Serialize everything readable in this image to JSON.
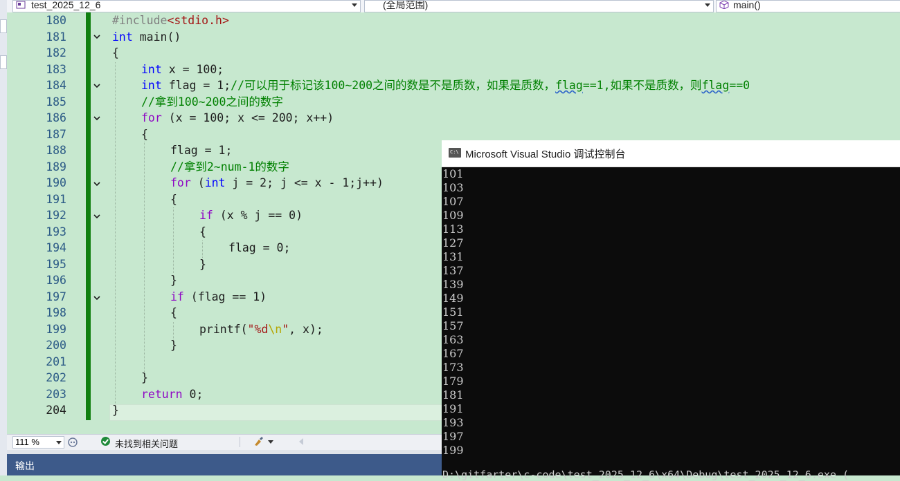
{
  "nav": {
    "project": "test_2025_12_6",
    "scope": "(全局范围)",
    "member": "main()"
  },
  "editor": {
    "lines": [
      {
        "num": "180"
      },
      {
        "num": "181"
      },
      {
        "num": "182"
      },
      {
        "num": "183"
      },
      {
        "num": "184"
      },
      {
        "num": "185"
      },
      {
        "num": "186"
      },
      {
        "num": "187"
      },
      {
        "num": "188"
      },
      {
        "num": "189"
      },
      {
        "num": "190"
      },
      {
        "num": "191"
      },
      {
        "num": "192"
      },
      {
        "num": "193"
      },
      {
        "num": "194"
      },
      {
        "num": "195"
      },
      {
        "num": "196"
      },
      {
        "num": "197"
      },
      {
        "num": "198"
      },
      {
        "num": "199"
      },
      {
        "num": "200"
      },
      {
        "num": "201"
      },
      {
        "num": "202"
      },
      {
        "num": "203"
      },
      {
        "num": "204"
      }
    ],
    "code": {
      "l180_pp": "#include",
      "l180_hdr": "<stdio.h>",
      "l181_kw": "int",
      "l181_rest": " main()",
      "l182": "{",
      "l183_kw": "int",
      "l183_rest": " x = 100;",
      "l184_kw": "int",
      "l184_rest": " flag = 1;",
      "l184_cmt_a": "//可以用于标记该100~200之间的数是不是质数，如果是质数，",
      "l184_cmt_b": "flag",
      "l184_cmt_c": "==1,如果不是质数，则",
      "l184_cmt_d": "flag",
      "l184_cmt_e": "==0",
      "l185_cmt": "//拿到100~200之间的数字",
      "l186_kw": "for",
      "l186_rest": " (x = 100; x <= 200; x++)",
      "l187": "{",
      "l188": "flag = 1;",
      "l189_cmt": "//拿到2~num-1的数字",
      "l190_kw": "for",
      "l190_a": " (",
      "l190_kw2": "int",
      "l190_rest": " j = 2; j <= x - 1;j++)",
      "l191": "{",
      "l192_kw": "if",
      "l192_rest": " (x % j == 0)",
      "l193": "{",
      "l194": "flag = 0;",
      "l195": "}",
      "l196": "}",
      "l197_kw": "if",
      "l197_rest": " (flag == 1)",
      "l198": "{",
      "l199_a": "printf(",
      "l199_str1": "\"%d",
      "l199_esc": "\\n",
      "l199_str2": "\"",
      "l199_rest": ", x);",
      "l200": "}",
      "l201": "",
      "l202": "}",
      "l203_kw": "return",
      "l203_rest": " 0;",
      "l204": "}"
    }
  },
  "console": {
    "title": "Microsoft Visual Studio 调试控制台",
    "icon_text": "C:\\",
    "output": [
      "101",
      "103",
      "107",
      "109",
      "113",
      "127",
      "131",
      "137",
      "139",
      "149",
      "151",
      "157",
      "163",
      "167",
      "173",
      "179",
      "181",
      "191",
      "193",
      "197",
      "199"
    ],
    "path_line": "D:\\gitfarter\\c-code\\test_2025_12_6\\x64\\Debug\\test_2025_12_6.exe ("
  },
  "status": {
    "zoom": "111 %",
    "issues": "未找到相关问题"
  },
  "output_panel": {
    "label": "输出"
  },
  "colors": {
    "editor_bg": "#c7e8cf",
    "keyword": "#0000ff",
    "comment": "#008000",
    "string": "#a31515",
    "change_bar": "#108010",
    "console_bg": "#0c0c0c"
  }
}
